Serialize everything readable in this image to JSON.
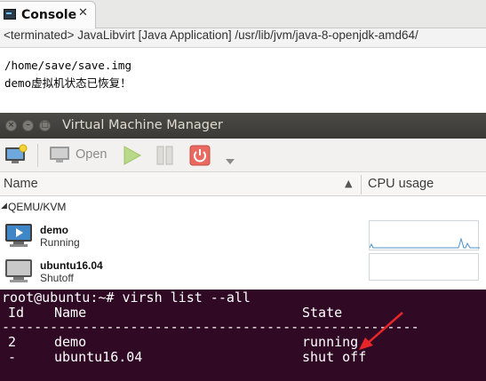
{
  "console": {
    "tab_title": "Console",
    "tab_close": "✕",
    "status_line": "<terminated> JavaLibvirt [Java Application] /usr/lib/jvm/java-8-openjdk-amd64/",
    "output": [
      "/home/save/save.img",
      "demo虚拟机状态已恢复！"
    ]
  },
  "vmm": {
    "title": "Virtual Machine Manager",
    "toolbar": {
      "open_label": "Open"
    },
    "columns": {
      "name": "Name",
      "cpu": "CPU usage"
    },
    "group": "QEMU/KVM",
    "vms": [
      {
        "name": "demo",
        "state": "Running",
        "icon": "monitor-play-icon"
      },
      {
        "name": "ubuntu16.04",
        "state": "Shutoff",
        "icon": "monitor-off-icon"
      }
    ],
    "colors": {
      "titlebar": "#3c3b37",
      "run": "#8bc34a",
      "stop": "#e0524a",
      "graph": "#4a90c8"
    }
  },
  "terminal": {
    "prompt": "root@ubuntu:~# virsh list --all",
    "headers": {
      "id": "Id",
      "name": "Name",
      "state": "State"
    },
    "separator": "----------------------------------------------------",
    "rows": [
      {
        "id": "2",
        "name": "demo",
        "state": "running"
      },
      {
        "id": "-",
        "name": "ubuntu16.04",
        "state": "shut off"
      }
    ],
    "colors": {
      "background": "#300a24",
      "annotation_arrow": "#e8262a"
    }
  }
}
